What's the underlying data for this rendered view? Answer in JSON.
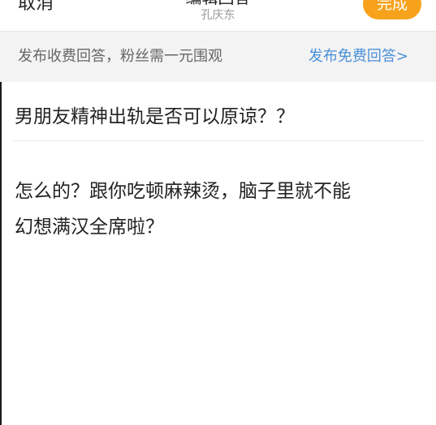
{
  "nav": {
    "cancel_label": "取消",
    "title": "编辑回答",
    "subtitle": "孔庆东",
    "done_label": "完成"
  },
  "notice": {
    "text": "发布收费回答，粉丝需一元围观",
    "link": "发布免费回答>"
  },
  "question": {
    "title": "男朋友精神出轨是否可以原谅？？"
  },
  "answer": {
    "body": "怎么的？跟你吃顿麻辣烫，脑子里就不能\n幻想满汉全席啦？"
  },
  "colors": {
    "accent": "#f7a21b",
    "link": "#4a90d9",
    "notice_bg": "#f3f3f3"
  }
}
